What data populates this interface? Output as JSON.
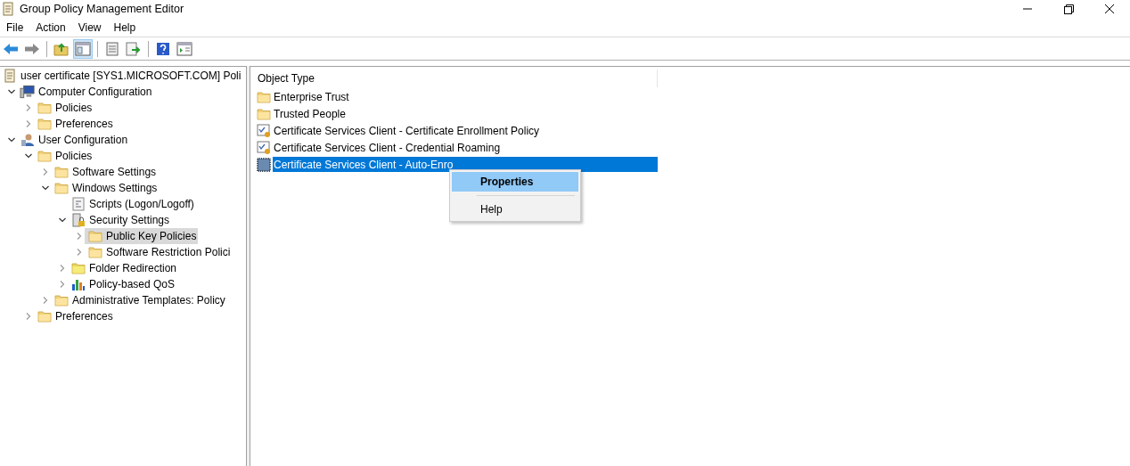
{
  "window": {
    "title": "Group Policy Management Editor"
  },
  "menu": [
    "File",
    "Action",
    "View",
    "Help"
  ],
  "toolbar": [
    {
      "kind": "back",
      "pressed": false
    },
    {
      "kind": "forward",
      "pressed": false
    },
    {
      "kind": "sep"
    },
    {
      "kind": "up",
      "pressed": false
    },
    {
      "kind": "tree",
      "pressed": true
    },
    {
      "kind": "sep"
    },
    {
      "kind": "list",
      "pressed": false
    },
    {
      "kind": "export",
      "pressed": false
    },
    {
      "kind": "sep"
    },
    {
      "kind": "help",
      "pressed": false
    },
    {
      "kind": "pane",
      "pressed": false
    }
  ],
  "tree": [
    {
      "label": "user certificate [SYS1.MICROSOFT.COM] Poli",
      "kind": "scroll",
      "selected": false,
      "children": [
        {
          "label": "Computer Configuration",
          "kind": "computer",
          "expanded": true,
          "selected": false,
          "children": [
            {
              "label": "Policies",
              "kind": "folder",
              "expanded": false,
              "selected": false
            },
            {
              "label": "Preferences",
              "kind": "folder",
              "expanded": false,
              "selected": false
            }
          ]
        },
        {
          "label": "User Configuration",
          "kind": "user",
          "expanded": true,
          "selected": false,
          "children": [
            {
              "label": "Policies",
              "kind": "folder",
              "expanded": true,
              "selected": false,
              "children": [
                {
                  "label": "Software Settings",
                  "kind": "folder",
                  "expanded": false,
                  "selected": false
                },
                {
                  "label": "Windows Settings",
                  "kind": "folder",
                  "expanded": true,
                  "selected": false,
                  "children": [
                    {
                      "label": "Scripts (Logon/Logoff)",
                      "kind": "script",
                      "selected": false
                    },
                    {
                      "label": "Security Settings",
                      "kind": "security",
                      "expanded": true,
                      "selected": false,
                      "children": [
                        {
                          "label": "Public Key Policies",
                          "kind": "folder",
                          "expanded": false,
                          "selected": true
                        },
                        {
                          "label": "Software Restriction Polici",
                          "kind": "folder",
                          "expanded": false,
                          "selected": false
                        }
                      ]
                    },
                    {
                      "label": "Folder Redirection",
                      "kind": "redirect",
                      "expanded": false,
                      "selected": false
                    },
                    {
                      "label": "Policy-based QoS",
                      "kind": "chart",
                      "expanded": false,
                      "selected": false
                    }
                  ]
                },
                {
                  "label": "Administrative Templates: Policy",
                  "kind": "folder",
                  "expanded": false,
                  "selected": false
                }
              ]
            },
            {
              "label": "Preferences",
              "kind": "folder",
              "expanded": false,
              "selected": false
            }
          ]
        }
      ]
    }
  ],
  "list": {
    "column": "Object Type",
    "rows": [
      {
        "label": "Enterprise Trust",
        "kind": "folder",
        "selected": false
      },
      {
        "label": "Trusted People",
        "kind": "folder",
        "selected": false
      },
      {
        "label": "Certificate Services Client - Certificate Enrollment Policy",
        "kind": "cert",
        "selected": false
      },
      {
        "label": "Certificate Services Client - Credential Roaming",
        "kind": "cert",
        "selected": false
      },
      {
        "label": "Certificate Services Client - Auto-Enro",
        "kind": "pattern",
        "selected": true
      }
    ]
  },
  "context_menu": [
    {
      "label": "Properties",
      "selected": true,
      "bold": true
    },
    {
      "label": "Help",
      "selected": false,
      "bold": false
    }
  ]
}
